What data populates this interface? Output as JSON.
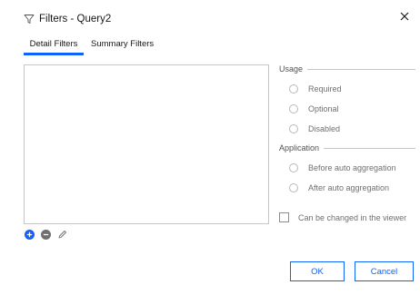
{
  "dialog": {
    "title": "Filters - Query2",
    "close_icon": "close-icon",
    "title_icon": "filter-icon"
  },
  "tabs": [
    {
      "label": "Detail Filters",
      "active": true
    },
    {
      "label": "Summary Filters",
      "active": false
    }
  ],
  "filter_actions": {
    "add_icon": "add-icon",
    "remove_icon": "remove-icon",
    "edit_icon": "edit-icon"
  },
  "usage": {
    "heading": "Usage",
    "options": [
      "Required",
      "Optional",
      "Disabled"
    ]
  },
  "application": {
    "heading": "Application",
    "options": [
      "Before auto aggregation",
      "After auto aggregation"
    ]
  },
  "viewer_checkbox": {
    "label": "Can be changed in the viewer",
    "checked": false
  },
  "footer": {
    "ok_label": "OK",
    "cancel_label": "Cancel"
  },
  "colors": {
    "accent": "#0f62fe",
    "border": "#c6c6c6"
  }
}
